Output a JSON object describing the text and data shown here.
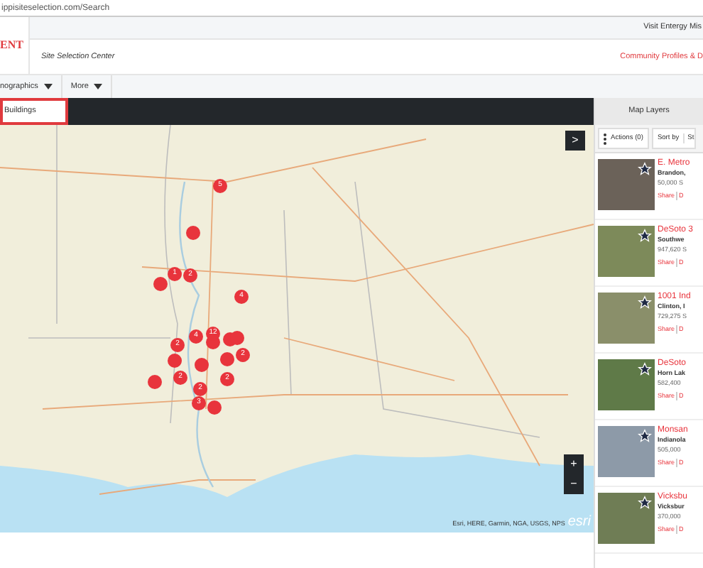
{
  "address_bar": {
    "url": "ippisiteselection.com/Search"
  },
  "header": {
    "top_link": "Visit Entergy Mis",
    "logo": "ENT",
    "subtitle": "Site Selection Center",
    "right_link": "Community Profiles & D"
  },
  "nav": [
    {
      "label": "nographics",
      "dropdown": true
    },
    {
      "label": "More",
      "dropdown": true
    }
  ],
  "search": {
    "value": "Buildings"
  },
  "map": {
    "expand_button": ">",
    "markers": [
      {
        "kind": "count",
        "label": "5"
      },
      {
        "kind": "point"
      },
      {
        "kind": "point"
      },
      {
        "kind": "count",
        "label": "1"
      },
      {
        "kind": "count",
        "label": "2"
      },
      {
        "kind": "count",
        "label": "4"
      },
      {
        "kind": "count",
        "label": "2"
      },
      {
        "kind": "count",
        "label": "4"
      },
      {
        "kind": "point"
      },
      {
        "kind": "count",
        "label": "12"
      },
      {
        "kind": "point"
      },
      {
        "kind": "point"
      },
      {
        "kind": "count",
        "label": "2"
      },
      {
        "kind": "point"
      },
      {
        "kind": "point"
      },
      {
        "kind": "point"
      },
      {
        "kind": "point"
      },
      {
        "kind": "count",
        "label": "2"
      },
      {
        "kind": "count",
        "label": "2"
      },
      {
        "kind": "count",
        "label": "2"
      },
      {
        "kind": "count",
        "label": "3"
      },
      {
        "kind": "point"
      }
    ],
    "zoom_in": "+",
    "zoom_out": "−",
    "attribution": "Esri, HERE, Garmin, NGA, USGS, NPS",
    "logo": "esri"
  },
  "panel": {
    "title": "Map Layers",
    "actions": "Actions (0)",
    "sort": "Sort by",
    "sort_value": "St",
    "listings": [
      {
        "title": "E. Metro",
        "location": "Brandon,",
        "size": "50,000 S",
        "share": "Share",
        "details": "D"
      },
      {
        "title": "DeSoto 3",
        "location": "Southwe",
        "size": "947,620 S",
        "share": "Share",
        "details": "D"
      },
      {
        "title": "1001 Ind",
        "location": "Clinton, I",
        "size": "729,275 S",
        "share": "Share",
        "details": "D"
      },
      {
        "title": "DeSoto",
        "location": "Horn Lak",
        "size": "582,400",
        "share": "Share",
        "details": "D"
      },
      {
        "title": "Monsan",
        "location": "Indianola",
        "size": "505,000",
        "share": "Share",
        "details": "D"
      },
      {
        "title": "Vicksbu",
        "location": "Vicksbur",
        "size": "370,000",
        "share": "Share",
        "details": "D"
      }
    ]
  }
}
